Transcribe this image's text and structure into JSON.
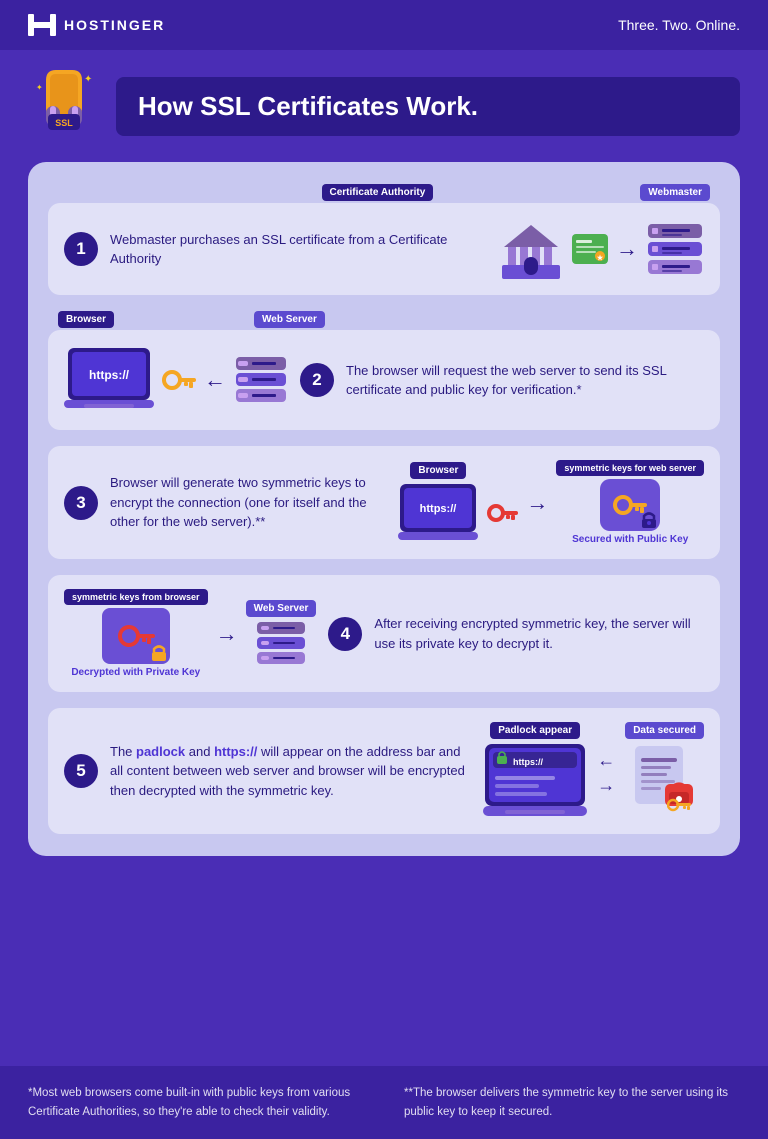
{
  "header": {
    "logo_text": "HOSTINGER",
    "tagline": "Three. Two. Online."
  },
  "title": {
    "main": "How SSL Certificates Work."
  },
  "steps": [
    {
      "number": "1",
      "text": "Webmaster purchases an SSL certificate from a Certificate Authority",
      "label_left": "Certificate Authority",
      "label_right": "Webmaster"
    },
    {
      "number": "2",
      "text": "The browser will request the web server to send its SSL certificate and public key for verification.*",
      "label_left": "Browser",
      "label_right": "Web Server"
    },
    {
      "number": "3",
      "text": "Browser will generate two symmetric keys to encrypt the connection (one for itself and the other for the web server).**",
      "label_left": "Browser",
      "label_right": "symmetric keys for web server",
      "sublabel_right": "Secured with Public Key"
    },
    {
      "number": "4",
      "text": "After receiving encrypted symmetric key, the server will use its private key to decrypt it.",
      "label_left": "symmetric keys from browser",
      "label_right": "Web Server",
      "sublabel_left": "Decrypted with Private Key"
    },
    {
      "number": "5",
      "text_part1": "The padlock",
      "text_link": "https://",
      "text_part2": " and ",
      "text_highlight": "https://",
      "text_part3": " will appear on the address bar and all content between web server and browser will be encrypted then decrypted with the symmetric key.",
      "label_left": "Padlock appear",
      "label_right": "Data secured"
    }
  ],
  "footer": {
    "note1": "*Most web browsers come built-in with public keys from various Certificate Authorities, so they're able to check their validity.",
    "note2": "**The browser delivers the symmetric key to the server using its public key to keep it secured."
  }
}
